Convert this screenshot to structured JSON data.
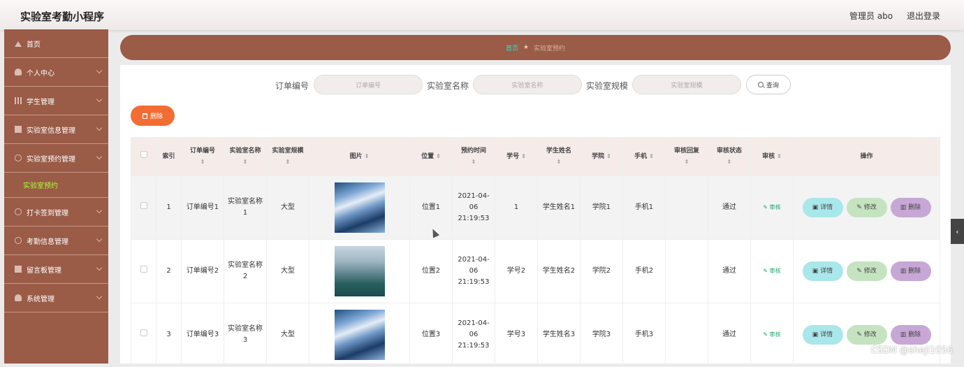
{
  "header": {
    "app_title": "实验室考勤小程序",
    "admin_label": "管理员 abo",
    "logout_label": "退出登录"
  },
  "sidebar": {
    "items": [
      {
        "label": "首页",
        "icon": "home-icon"
      },
      {
        "label": "个人中心",
        "icon": "user-icon"
      },
      {
        "label": "学生管理",
        "icon": "bar-chart-icon"
      },
      {
        "label": "实验室信息管理",
        "icon": "square-icon"
      },
      {
        "label": "实验室预约管理",
        "icon": "circle-icon",
        "sub": "实验室预约"
      },
      {
        "label": "打卡签到管理",
        "icon": "circle-icon"
      },
      {
        "label": "考勤信息管理",
        "icon": "circle-icon"
      },
      {
        "label": "留言板管理",
        "icon": "square-icon"
      },
      {
        "label": "系统管理",
        "icon": "user-icon"
      }
    ]
  },
  "breadcrumb": {
    "home": "首页",
    "separator": "★",
    "current": "实验室预约"
  },
  "search": {
    "order_label": "订单编号",
    "order_placeholder": "订单编号",
    "name_label": "实验室名称",
    "name_placeholder": "实验室名称",
    "scale_label": "实验室规模",
    "scale_placeholder": "实验室规模",
    "button": "查询"
  },
  "toolbar": {
    "delete_label": "删除"
  },
  "table": {
    "headers": {
      "index": "索引",
      "order_no": "订单编号",
      "lab_name": "实验室名称",
      "scale": "实验室规模",
      "image": "图片",
      "location": "位置",
      "time": "预约时间",
      "student_id": "学号",
      "student_name": "学生姓名",
      "college": "学院",
      "phone": "手机",
      "reply": "审核回复",
      "status": "审核状态",
      "audit": "审核",
      "actions": "操作"
    },
    "sort_glyph": "⇕",
    "rows": [
      {
        "index": "1",
        "order_no": "订单编号1",
        "lab_name": "实验室名称1",
        "scale": "大型",
        "location": "位置1",
        "time": "2021-04-06 21:19:53",
        "student_id": "1",
        "student_name": "学生姓名1",
        "college": "学院1",
        "phone": "手机1",
        "reply": "",
        "status": "通过",
        "audit": "审核"
      },
      {
        "index": "2",
        "order_no": "订单编号2",
        "lab_name": "实验室名称2",
        "scale": "大型",
        "location": "位置2",
        "time": "2021-04-06 21:19:53",
        "student_id": "学号2",
        "student_name": "学生姓名2",
        "college": "学院2",
        "phone": "手机2",
        "reply": "",
        "status": "通过",
        "audit": "审核"
      },
      {
        "index": "3",
        "order_no": "订单编号3",
        "lab_name": "实验室名称3",
        "scale": "大型",
        "location": "位置3",
        "time": "2021-04-06 21:19:53",
        "student_id": "学号3",
        "student_name": "学生姓名3",
        "college": "学院3",
        "phone": "手机3",
        "reply": "",
        "status": "通过",
        "audit": "审核"
      }
    ],
    "actions": {
      "detail": "详情",
      "edit": "修改",
      "delete": "删除"
    }
  },
  "side_tab": "‹",
  "watermark": "CSDN @sheji1056",
  "colors": {
    "sidebar": "#9a5b47",
    "delete_button": "#f36d33",
    "detail": "#a9e7ea",
    "edit": "#c5e3c1",
    "remove": "#c7a7d6",
    "active_submenu": "#aaff34"
  }
}
